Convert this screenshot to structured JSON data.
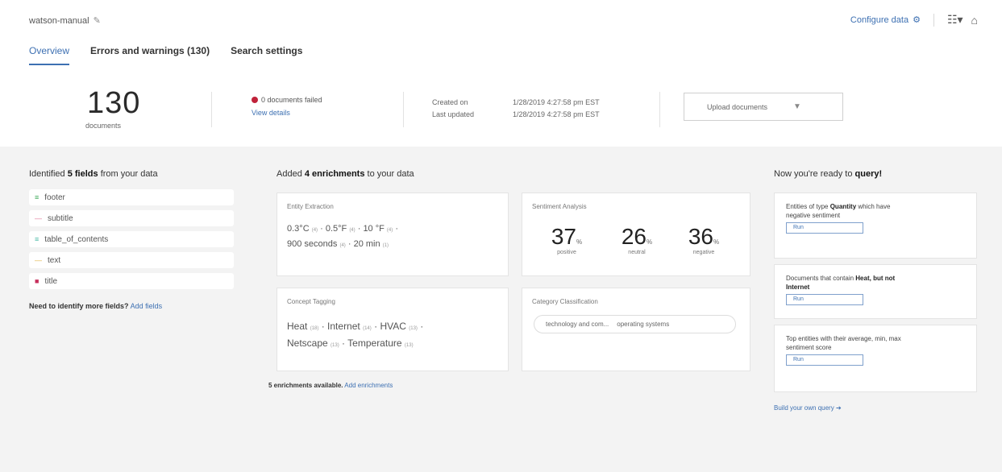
{
  "header": {
    "collection_name": "watson-manual",
    "configure_label": "Configure data",
    "tabs": [
      {
        "label": "Overview",
        "active": true
      },
      {
        "label": "Errors and warnings (130)",
        "active": false
      },
      {
        "label": "Search settings",
        "active": false
      }
    ]
  },
  "stats": {
    "document_count": "130",
    "document_label": "documents",
    "failed_text": "0 documents failed",
    "view_details": "View details",
    "created_label": "Created on",
    "created_value": "1/28/2019 4:27:58 pm EST",
    "updated_label": "Last updated",
    "updated_value": "1/28/2019 4:27:58 pm EST",
    "upload_label": "Upload documents"
  },
  "fields_panel": {
    "title_prefix": "Identified",
    "title_bold": "5 fields",
    "title_suffix": "from your data",
    "fields": [
      {
        "name": "footer",
        "mark": "≡",
        "color": "#3aa856"
      },
      {
        "name": "subtitle",
        "mark": "—",
        "color": "#e27b9c"
      },
      {
        "name": "table_of_contents",
        "mark": "≡",
        "color": "#47b9a4"
      },
      {
        "name": "text",
        "mark": "—",
        "color": "#e0b44a"
      },
      {
        "name": "title",
        "mark": "■",
        "color": "#c72f5b"
      }
    ],
    "more_prefix": "Need to",
    "more_bold": "identify more fields?",
    "more_link": "Add fields"
  },
  "enrichments": {
    "title_prefix": "Added",
    "title_bold": "4 enrichments",
    "title_suffix": "to your data",
    "entity": {
      "title": "Entity Extraction",
      "items": [
        {
          "text": "0.3°C",
          "score": "(4)"
        },
        {
          "text": "0.5°F",
          "score": "(4)"
        },
        {
          "text": "10 °F",
          "score": "(4)"
        },
        {
          "text": "900 seconds",
          "score": "(4)"
        },
        {
          "text": "20 min",
          "score": "(1)"
        }
      ]
    },
    "sentiment": {
      "title": "Sentiment Analysis",
      "values": [
        {
          "value": "37",
          "unit": "%",
          "label": "positive"
        },
        {
          "value": "26",
          "unit": "%",
          "label": "neutral"
        },
        {
          "value": "36",
          "unit": "%",
          "label": "negative"
        }
      ]
    },
    "concept": {
      "title": "Concept Tagging",
      "items": [
        {
          "text": "Heat",
          "score": "(18)"
        },
        {
          "text": "Internet",
          "score": "(14)"
        },
        {
          "text": "HVAC",
          "score": "(13)"
        },
        {
          "text": "Netscape",
          "score": "(13)"
        },
        {
          "text": "Temperature",
          "score": "(13)"
        }
      ]
    },
    "category": {
      "title": "Category Classification",
      "pill_a": "technology and com...",
      "pill_b": "operating systems"
    },
    "available_bold": "5 enrichments available.",
    "available_link": "Add enrichments"
  },
  "query_panel": {
    "title_prefix": "Now you're ready to",
    "title_bold": "query!",
    "cards": [
      {
        "prefix": "Entities of type ",
        "bold": "Quantity",
        "suffix": " which have negative sentiment",
        "run": "Run"
      },
      {
        "prefix": "Documents that contain ",
        "bold": "Heat, but not Internet",
        "suffix": "",
        "run": "Run"
      },
      {
        "prefix": "",
        "bold": "Top entities with their average, min, max sentiment score",
        "suffix": "",
        "run": "Run"
      }
    ],
    "build_link": "Build your own query"
  }
}
